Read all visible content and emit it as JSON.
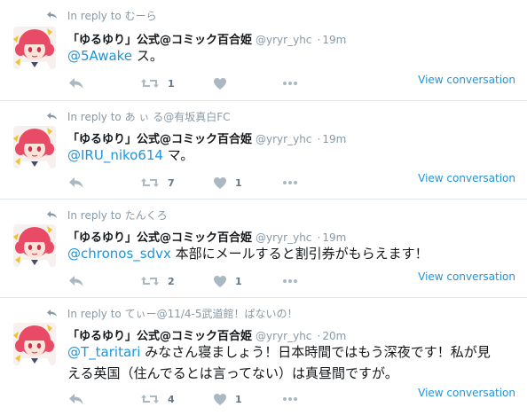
{
  "colors": {
    "link": "#1b95e0",
    "muted": "#8899a6",
    "border": "#e1e8ed"
  },
  "tweets": [
    {
      "reply_to_prefix": "In reply to",
      "reply_to_name": "むーら",
      "fullname": "「ゆるゆり」公式@コミック百合姫",
      "screen_name": "@yryr_yhc",
      "dot": "·",
      "time": "19m",
      "mention": "@5Awake",
      "text": " ス。",
      "text_line2": "",
      "retweets": "1",
      "likes": "",
      "view_label": "View conversation"
    },
    {
      "reply_to_prefix": "In reply to",
      "reply_to_name": "あ ぃ る@有坂真白FC",
      "fullname": "「ゆるゆり」公式@コミック百合姫",
      "screen_name": "@yryr_yhc",
      "dot": "·",
      "time": "19m",
      "mention": "@IRU_niko614",
      "text": " マ。",
      "text_line2": "",
      "retweets": "7",
      "likes": "1",
      "view_label": "View conversation"
    },
    {
      "reply_to_prefix": "In reply to",
      "reply_to_name": "たんくろ",
      "fullname": "「ゆるゆり」公式@コミック百合姫",
      "screen_name": "@yryr_yhc",
      "dot": "·",
      "time": "19m",
      "mention": "@chronos_sdvx",
      "text": " 本部にメールすると割引券がもらえます！",
      "text_line2": "",
      "retweets": "2",
      "likes": "1",
      "view_label": "View conversation"
    },
    {
      "reply_to_prefix": "In reply to",
      "reply_to_name": "てぃー@11/4-5武道館！ぱないの！",
      "fullname": "「ゆるゆり」公式@コミック百合姫",
      "screen_name": "@yryr_yhc",
      "dot": "·",
      "time": "20m",
      "mention": "@T_taritari",
      "text": " みなさん寝ましょう！日本時間ではもう深夜です！私が見",
      "text_line2": "える英国（住んでるとは言ってない）は真昼間ですが。",
      "retweets": "4",
      "likes": "1",
      "view_label": "View conversation"
    }
  ]
}
